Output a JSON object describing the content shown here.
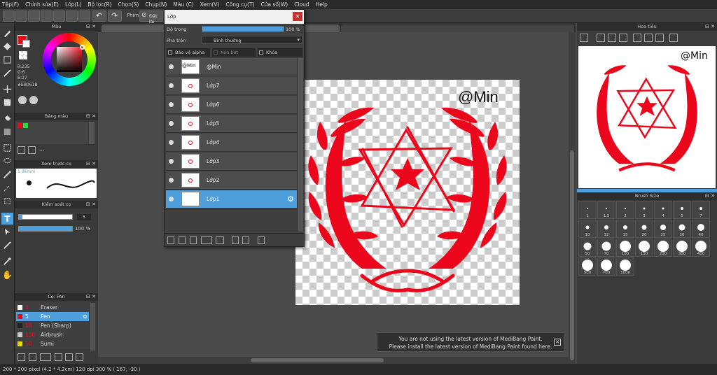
{
  "menu": [
    "Tệp(F)",
    "Chỉnh sửa(E)",
    "Lớp(L)",
    "Bộ lọc(R)",
    "Chọn(S)",
    "Chụp(N)",
    "Màu (C)",
    "Xem(V)",
    "Công cụ(T)",
    "Cửa sổ(W)",
    "Cloud",
    "Help"
  ],
  "toolbar": {
    "label_phim": "Phím",
    "label_dat_lai": "Đặt lại"
  },
  "color_panel": {
    "title": "Màu",
    "r": "R:235",
    "g": "G:6",
    "b": "B:27",
    "hex": "#EB061B"
  },
  "palette_panel": {
    "title": "Bảng màu",
    "value": "---"
  },
  "brush_preview": {
    "title": "Xem trước cọ",
    "size": "1.06mm"
  },
  "brush_control": {
    "title": "Kiểm soát cọ",
    "size_value": "5",
    "opacity_value": "100 %"
  },
  "brush_list": {
    "title": "Cọ: Pen",
    "items": [
      {
        "num": "4",
        "name": "Eraser",
        "color": "#ffffff"
      },
      {
        "num": "5",
        "name": "Pen",
        "color": "#eb061b"
      },
      {
        "num": "10",
        "name": "Pen (Sharp)",
        "color": "#222222"
      },
      {
        "num": "100",
        "name": "Airbrush",
        "color": "#cccccc"
      },
      {
        "num": "50",
        "name": "Sumi",
        "color": "#e8d800"
      }
    ]
  },
  "layer_window": {
    "title": "Lớp",
    "opacity_label": "Độ trong",
    "opacity_value": "100 %",
    "opacity_fill": 1.0,
    "blend_label": "Pha trộn",
    "blend_value": "Bình thường",
    "protect_alpha": "Bảo vệ alpha",
    "clipping": "Xén bớt",
    "lock": "Khóa",
    "layers": [
      {
        "name": "@Min",
        "thumb": "@Min",
        "selected": false
      },
      {
        "name": "Lớp7",
        "thumb": "",
        "selected": false
      },
      {
        "name": "Lớp6",
        "thumb": "",
        "selected": false
      },
      {
        "name": "Lớp5",
        "thumb": "",
        "selected": false
      },
      {
        "name": "Lớp4",
        "thumb": "",
        "selected": false
      },
      {
        "name": "Lớp3",
        "thumb": "",
        "selected": false
      },
      {
        "name": "Lớp2",
        "thumb": "",
        "selected": false
      },
      {
        "name": "Lớp1",
        "thumb": "",
        "selected": true
      }
    ]
  },
  "canvas": {
    "watermark": "@Min"
  },
  "navigator": {
    "title": "Hoa tiêu",
    "watermark": "@Min"
  },
  "brush_size": {
    "title": "Brush Size",
    "sizes": [
      "1",
      "1.5",
      "2",
      "3",
      "4",
      "5",
      "7",
      "10",
      "12",
      "15",
      "20",
      "25",
      "30",
      "40",
      "50",
      "70",
      "100",
      "150",
      "200",
      "300",
      "400",
      "500",
      "700",
      "1000"
    ]
  },
  "toast": {
    "line1": "You are not using the latest version of MediBang Paint.",
    "line2": "Please install the latest version of MediBang Paint found here."
  },
  "status": {
    "text": "200 * 200 pixel  (4.2 * 4.2cm)  120 dpi  300 %  ( 167, -30 )"
  },
  "colors": {
    "accent": "#4f9fdc",
    "red": "#eb061b"
  }
}
